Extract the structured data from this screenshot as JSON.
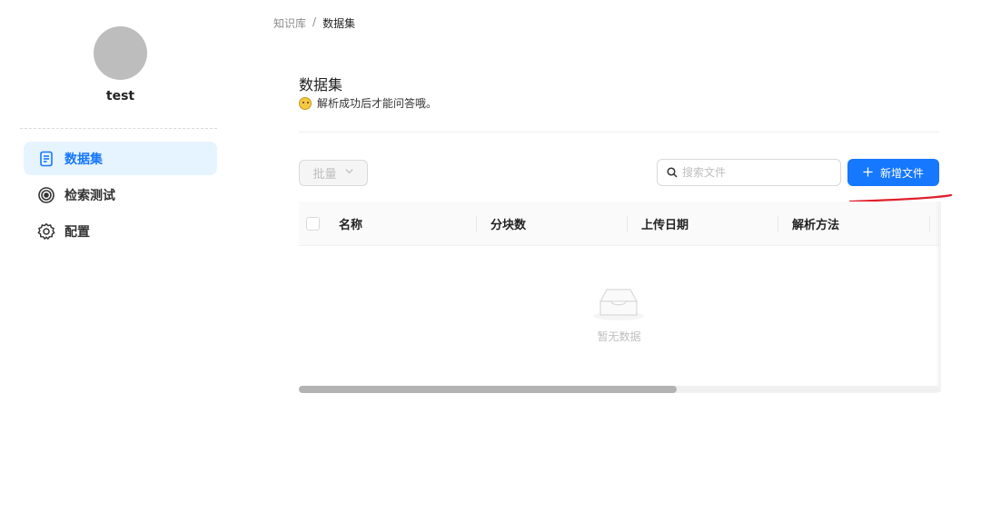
{
  "sidebar": {
    "username": "test",
    "items": [
      {
        "label": "数据集",
        "icon": "document-icon",
        "active": true
      },
      {
        "label": "检索测试",
        "icon": "target-icon",
        "active": false
      },
      {
        "label": "配置",
        "icon": "gear-icon",
        "active": false
      }
    ]
  },
  "breadcrumb": {
    "parent": "知识库",
    "separator": "/",
    "current": "数据集"
  },
  "header": {
    "title": "数据集",
    "subtitle": "解析成功后才能问答哦。",
    "subtitle_icon": "smiley-icon"
  },
  "toolbar": {
    "batch_label": "批量",
    "search_placeholder": "搜索文件",
    "add_label": "新增文件"
  },
  "table": {
    "columns": [
      "名称",
      "分块数",
      "上传日期",
      "解析方法"
    ],
    "rows": [],
    "empty_text": "暂无数据"
  },
  "colors": {
    "accent": "#1677ff",
    "active_bg": "#e6f4ff",
    "annotation": "#e0202b"
  }
}
